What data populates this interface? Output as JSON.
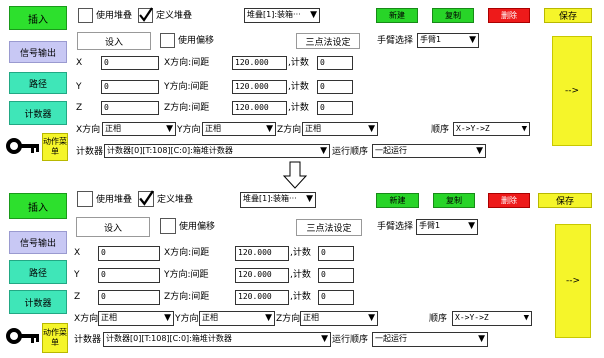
{
  "sidebar": {
    "insert": "插入",
    "signal_output": "信号输出",
    "path": "路径",
    "counter": "计数器",
    "action_menu": "动作菜单"
  },
  "top": {
    "use_stack": "使用堆叠",
    "define_stack": "定义堆叠",
    "stack_select": "堆叠[1]:装箱···",
    "new": "新建",
    "copy": "复制",
    "delete": "删除",
    "save": "保存",
    "set_in": "设入",
    "use_offset": "使用偏移",
    "three_point": "三点法设定",
    "arm_select_label": "手臂选择",
    "arm_select": "手臂1",
    "arrow_btn": "-->",
    "axes": [
      {
        "axis": "X",
        "value": "0",
        "spacing_label": "X方向:间距",
        "spacing": "120.000",
        "count_label": ",计数",
        "count": "0"
      },
      {
        "axis": "Y",
        "value": "0",
        "spacing_label": "Y方向:间距",
        "spacing": "120.000",
        "count_label": ",计数",
        "count": "0"
      },
      {
        "axis": "Z",
        "value": "0",
        "spacing_label": "Z方向:间距",
        "spacing": "120.000",
        "count_label": ",计数",
        "count": "0"
      }
    ],
    "x_dir_label": "X方向",
    "x_dir": "正相",
    "y_dir_label": "Y方向",
    "y_dir": "正相",
    "z_dir_label": "Z方向",
    "z_dir": "正相",
    "order_label": "顺序",
    "order": "X->Y->Z",
    "counter_label": "计数器",
    "counter_select": "计数器[0][T:108][C:0]:箱堆计数器",
    "run_order_label": "运行顺序",
    "run_order": "一起运行"
  },
  "bottom": {
    "use_stack": "使用堆叠",
    "define_stack": "定义堆叠",
    "stack_select": "堆叠[1]:装箱···",
    "new": "新建",
    "copy": "复制",
    "delete": "删除",
    "save": "保存",
    "set_in": "设入",
    "use_offset": "使用偏移",
    "three_point": "三点法设定",
    "arm_select_label": "手臂选择",
    "arm_select": "手臂1",
    "arrow_btn": "-->",
    "axes": [
      {
        "axis": "X",
        "value": "0",
        "spacing_label": "X方向:间距",
        "spacing": "120.000",
        "count_label": ",计数",
        "count": "0"
      },
      {
        "axis": "Y",
        "value": "0",
        "spacing_label": "Y方向:间距",
        "spacing": "120.000",
        "count_label": ",计数",
        "count": "0"
      },
      {
        "axis": "Z",
        "value": "0",
        "spacing_label": "Z方向:间距",
        "spacing": "120.000",
        "count_label": ",计数",
        "count": "0"
      }
    ],
    "x_dir_label": "X方向",
    "x_dir": "正相",
    "y_dir_label": "Y方向",
    "y_dir": "正相",
    "z_dir_label": "Z方向",
    "z_dir": "正相",
    "order_label": "顺序",
    "order": "X->Y->Z",
    "counter_label": "计数器",
    "counter_select": "计数器[0][T:108][C:0]:箱堆计数器",
    "run_order_label": "运行顺序",
    "run_order": "一起运行"
  },
  "colors": {
    "green_button": "#28d428",
    "red_button": "#ee1a1a",
    "yellow_button": "#f5f52a",
    "lavender_button": "#c8c8f4",
    "teal_button": "#3fe6b8"
  },
  "icons": {
    "check": "check-mark-icon",
    "dropdown": "triangle-down-icon",
    "down_arrow": "down-arrow-icon",
    "logo": "key-logo-icon"
  }
}
